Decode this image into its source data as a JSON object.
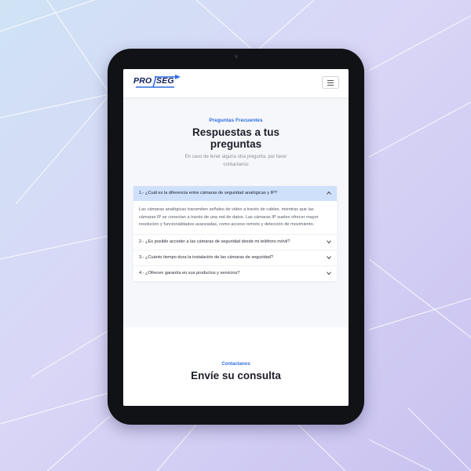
{
  "header": {
    "logo_part1": "PRO",
    "logo_part2": "SEG",
    "menu_icon": "hamburger-icon"
  },
  "faq": {
    "eyebrow": "Preguntas Frecuentes",
    "title_line1": "Respuestas a tus",
    "title_line2": "preguntas",
    "subtitle_line1": "En caso de tener alguna otra pregunta, por favor",
    "subtitle_line2": "contactanos",
    "items": [
      {
        "question": "1.- ¿Cuál es la diferencia entre cámaras de seguridad analógicas y IP?",
        "answer": "Las cámaras analógicas transmiten señales de video a través de cables, mientras que las cámaras IP se conectan a través de una red de datos. Las cámaras IP suelen ofrecer mayor resolución y funcionalidades avanzadas, como acceso remoto y detección de movimiento.",
        "expanded": true
      },
      {
        "question": "2.- ¿Es posible acceder a las cámaras de seguridad desde mi teléfono móvil?",
        "expanded": false
      },
      {
        "question": "3.- ¿Cuánto tiempo dura la instalación de las cámaras de seguridad?",
        "expanded": false
      },
      {
        "question": "4.- ¿Ofrecen garantía en sus productos y servicios?",
        "expanded": false
      }
    ]
  },
  "contact": {
    "eyebrow": "Contactanos",
    "title": "Envíe su consulta"
  },
  "colors": {
    "accent": "#2f6fe0",
    "brand_dark": "#0f1c5c",
    "open_question_bg": "#cfe0fb",
    "tablet_frame": "#111216"
  }
}
